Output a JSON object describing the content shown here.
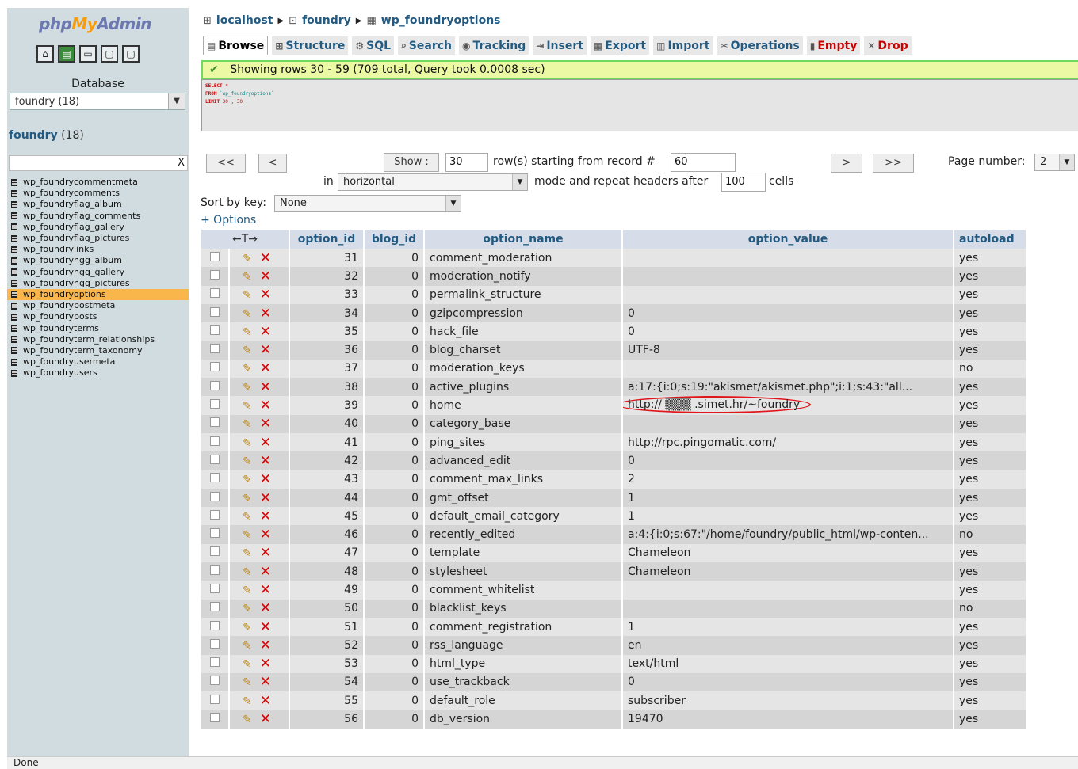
{
  "sidebar": {
    "logo_php": "php",
    "logo_my": "My",
    "logo_admin": "Admin",
    "icons": [
      "home-icon",
      "query-window-icon",
      "sql-docs-icon",
      "docs-icon",
      "reload-icon"
    ],
    "database_label": "Database",
    "database_select": "foundry (18)",
    "db_link_name": "foundry",
    "db_link_count": "(18)",
    "filter_clear": "X",
    "tables": [
      {
        "name": "wp_foundrycommentmeta",
        "active": false
      },
      {
        "name": "wp_foundrycomments",
        "active": false
      },
      {
        "name": "wp_foundryflag_album",
        "active": false
      },
      {
        "name": "wp_foundryflag_comments",
        "active": false
      },
      {
        "name": "wp_foundryflag_gallery",
        "active": false
      },
      {
        "name": "wp_foundryflag_pictures",
        "active": false
      },
      {
        "name": "wp_foundrylinks",
        "active": false
      },
      {
        "name": "wp_foundryngg_album",
        "active": false
      },
      {
        "name": "wp_foundryngg_gallery",
        "active": false
      },
      {
        "name": "wp_foundryngg_pictures",
        "active": false
      },
      {
        "name": "wp_foundryoptions",
        "active": true
      },
      {
        "name": "wp_foundrypostmeta",
        "active": false
      },
      {
        "name": "wp_foundryposts",
        "active": false
      },
      {
        "name": "wp_foundryterms",
        "active": false
      },
      {
        "name": "wp_foundryterm_relationships",
        "active": false
      },
      {
        "name": "wp_foundryterm_taxonomy",
        "active": false
      },
      {
        "name": "wp_foundryusermeta",
        "active": false
      },
      {
        "name": "wp_foundryusers",
        "active": false
      }
    ]
  },
  "breadcrumb": {
    "server": "localhost",
    "database": "foundry",
    "table": "wp_foundryoptions"
  },
  "tabs": [
    {
      "label": "Browse",
      "icon": "▤",
      "active": true,
      "danger": false
    },
    {
      "label": "Structure",
      "icon": "⊞",
      "active": false,
      "danger": false
    },
    {
      "label": "SQL",
      "icon": "⚙",
      "active": false,
      "danger": false
    },
    {
      "label": "Search",
      "icon": "⌕",
      "active": false,
      "danger": false
    },
    {
      "label": "Tracking",
      "icon": "◉",
      "active": false,
      "danger": false
    },
    {
      "label": "Insert",
      "icon": "⇥",
      "active": false,
      "danger": false
    },
    {
      "label": "Export",
      "icon": "▦",
      "active": false,
      "danger": false
    },
    {
      "label": "Import",
      "icon": "▥",
      "active": false,
      "danger": false
    },
    {
      "label": "Operations",
      "icon": "✂",
      "active": false,
      "danger": false
    },
    {
      "label": "Empty",
      "icon": "▮",
      "active": false,
      "danger": true
    },
    {
      "label": "Drop",
      "icon": "✕",
      "active": false,
      "danger": true
    }
  ],
  "message": "Showing rows 30 - 59 (709 total, Query took 0.0008 sec)",
  "sql": {
    "line1_kw": "SELECT",
    "line1_rest": " *",
    "line2_kw": "FROM",
    "line2_rest": " `wp_foundryoptions`",
    "line3_kw": "LIMIT",
    "line3_rest": " 30 , 30"
  },
  "nav": {
    "first": "<<",
    "prev": "<",
    "show_button": "Show :",
    "rows": "30",
    "rows_label": "row(s) starting from record #",
    "start_record": "60",
    "next": ">",
    "last": ">>",
    "page_number_label": "Page number:",
    "page_number": "2",
    "in_label": "in",
    "mode": "horizontal",
    "mode_label": "mode and repeat headers after",
    "repeat_headers": "100",
    "cells_label": "cells",
    "sort_label": "Sort by key:",
    "sort_value": "None",
    "options_link": "+ Options"
  },
  "table": {
    "arrows_header": "←T→",
    "columns": [
      "option_id",
      "blog_id",
      "option_name",
      "option_value",
      "autoload"
    ],
    "rows": [
      {
        "id": "31",
        "blog": "0",
        "name": "comment_moderation",
        "value": "",
        "autoload": "yes"
      },
      {
        "id": "32",
        "blog": "0",
        "name": "moderation_notify",
        "value": "",
        "autoload": "yes"
      },
      {
        "id": "33",
        "blog": "0",
        "name": "permalink_structure",
        "value": "",
        "autoload": "yes"
      },
      {
        "id": "34",
        "blog": "0",
        "name": "gzipcompression",
        "value": "0",
        "autoload": "yes"
      },
      {
        "id": "35",
        "blog": "0",
        "name": "hack_file",
        "value": "0",
        "autoload": "yes"
      },
      {
        "id": "36",
        "blog": "0",
        "name": "blog_charset",
        "value": "UTF-8",
        "autoload": "yes"
      },
      {
        "id": "37",
        "blog": "0",
        "name": "moderation_keys",
        "value": "",
        "autoload": "no"
      },
      {
        "id": "38",
        "blog": "0",
        "name": "active_plugins",
        "value": "a:17:{i:0;s:19:\"akismet/akismet.php\";i:1;s:43:\"all...",
        "autoload": "yes"
      },
      {
        "id": "39",
        "blog": "0",
        "name": "home",
        "value": "http:// ▒▒▒ .simet.hr/~foundry",
        "autoload": "yes",
        "circled": true
      },
      {
        "id": "40",
        "blog": "0",
        "name": "category_base",
        "value": "",
        "autoload": "yes"
      },
      {
        "id": "41",
        "blog": "0",
        "name": "ping_sites",
        "value": "http://rpc.pingomatic.com/",
        "autoload": "yes"
      },
      {
        "id": "42",
        "blog": "0",
        "name": "advanced_edit",
        "value": "0",
        "autoload": "yes"
      },
      {
        "id": "43",
        "blog": "0",
        "name": "comment_max_links",
        "value": "2",
        "autoload": "yes"
      },
      {
        "id": "44",
        "blog": "0",
        "name": "gmt_offset",
        "value": "1",
        "autoload": "yes"
      },
      {
        "id": "45",
        "blog": "0",
        "name": "default_email_category",
        "value": "1",
        "autoload": "yes"
      },
      {
        "id": "46",
        "blog": "0",
        "name": "recently_edited",
        "value": "a:4:{i:0;s:67:\"/home/foundry/public_html/wp-conten...",
        "autoload": "no"
      },
      {
        "id": "47",
        "blog": "0",
        "name": "template",
        "value": "Chameleon",
        "autoload": "yes"
      },
      {
        "id": "48",
        "blog": "0",
        "name": "stylesheet",
        "value": "Chameleon",
        "autoload": "yes"
      },
      {
        "id": "49",
        "blog": "0",
        "name": "comment_whitelist",
        "value": "",
        "autoload": "yes"
      },
      {
        "id": "50",
        "blog": "0",
        "name": "blacklist_keys",
        "value": "",
        "autoload": "no"
      },
      {
        "id": "51",
        "blog": "0",
        "name": "comment_registration",
        "value": "1",
        "autoload": "yes"
      },
      {
        "id": "52",
        "blog": "0",
        "name": "rss_language",
        "value": "en",
        "autoload": "yes"
      },
      {
        "id": "53",
        "blog": "0",
        "name": "html_type",
        "value": "text/html",
        "autoload": "yes"
      },
      {
        "id": "54",
        "blog": "0",
        "name": "use_trackback",
        "value": "0",
        "autoload": "yes"
      },
      {
        "id": "55",
        "blog": "0",
        "name": "default_role",
        "value": "subscriber",
        "autoload": "yes"
      },
      {
        "id": "56",
        "blog": "0",
        "name": "db_version",
        "value": "19470",
        "autoload": "yes"
      }
    ]
  },
  "status_bar": "Done",
  "colors": {
    "sidebar_bg": "#d0dce0",
    "link": "#235a81",
    "active_table": "#f8b64b",
    "success_border": "#6edb5e",
    "annotation": "#e0161b"
  }
}
